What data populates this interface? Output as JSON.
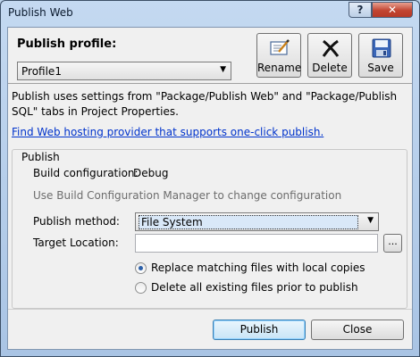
{
  "window": {
    "title": "Publish Web",
    "help_glyph": "?",
    "close_glyph": "✕"
  },
  "header": {
    "profile_label": "Publish profile:",
    "profile_selected": "Profile1",
    "buttons": {
      "rename": "Rename",
      "delete": "Delete",
      "save": "Save"
    }
  },
  "description": "Publish uses settings from \"Package/Publish Web\" and \"Package/Publish SQL\" tabs in Project Properties.",
  "hosting_link": "Find Web hosting provider that supports one-click publish.",
  "publish_group": {
    "legend": "Publish",
    "build_config_label": "Build configuration:",
    "build_config_value": "Debug",
    "build_config_hint": "Use Build Configuration Manager to change configuration",
    "method_label": "Publish method:",
    "method_value": "File System",
    "target_label": "Target Location:",
    "target_value": "",
    "browse_label": "...",
    "radio_replace": "Replace matching files with local copies",
    "radio_delete": "Delete all existing files prior to publish",
    "selected_option": "replace"
  },
  "footer": {
    "publish": "Publish",
    "close": "Close"
  }
}
